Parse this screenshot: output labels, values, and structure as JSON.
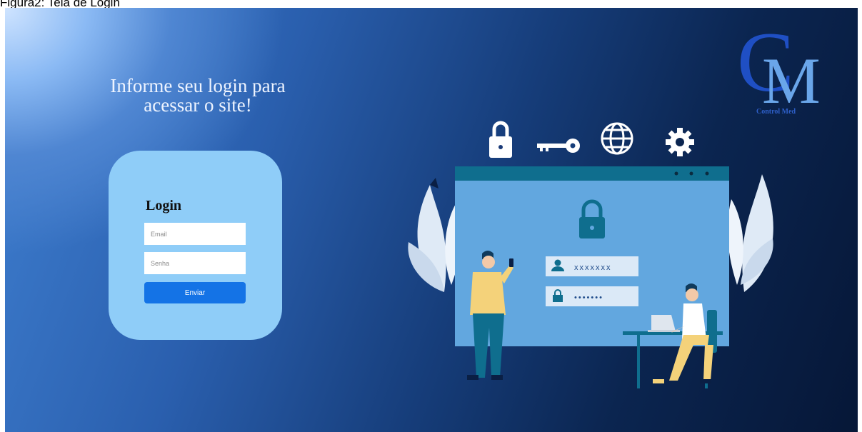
{
  "caption": "Figura2: Tela de Login",
  "headline": {
    "line1": "Informe seu login para",
    "line2": "acessar o site!"
  },
  "login": {
    "title": "Login",
    "email_placeholder": "Email",
    "password_placeholder": "Senha",
    "submit_label": "Enviar"
  },
  "logo": {
    "letter_c": "C",
    "letter_m": "M",
    "text": "Control Med"
  },
  "illustration": {
    "username_mask": "xxxxxxx",
    "password_mask": "•••••••",
    "icons": [
      "lock-icon",
      "key-icon",
      "globe-icon",
      "gear-icon"
    ]
  },
  "colors": {
    "card": "#8fcdf8",
    "button": "#1473e6",
    "logo_dark": "#1f4fc4",
    "logo_light": "#6aa6ea"
  }
}
